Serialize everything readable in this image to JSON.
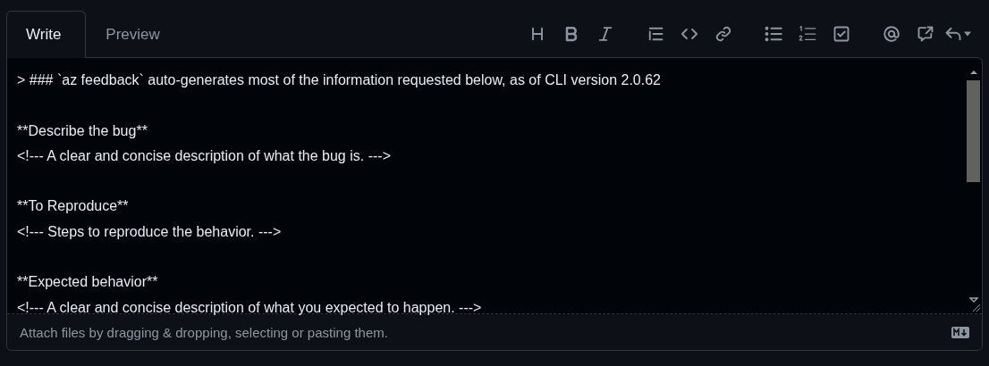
{
  "tabs": [
    {
      "label": "Write",
      "selected": true
    },
    {
      "label": "Preview",
      "selected": false
    }
  ],
  "editor": {
    "value": "> ### `az feedback` auto-generates most of the information requested below, as of CLI version 2.0.62\n\n**Describe the bug**\n<!--- A clear and concise description of what the bug is. --->\n\n**To Reproduce**\n<!--- Steps to reproduce the behavior. --->\n\n**Expected behavior**\n<!--- A clear and concise description of what you expected to happen. --->"
  },
  "footer": {
    "hint": "Attach files by dragging & dropping, selecting or pasting them."
  }
}
